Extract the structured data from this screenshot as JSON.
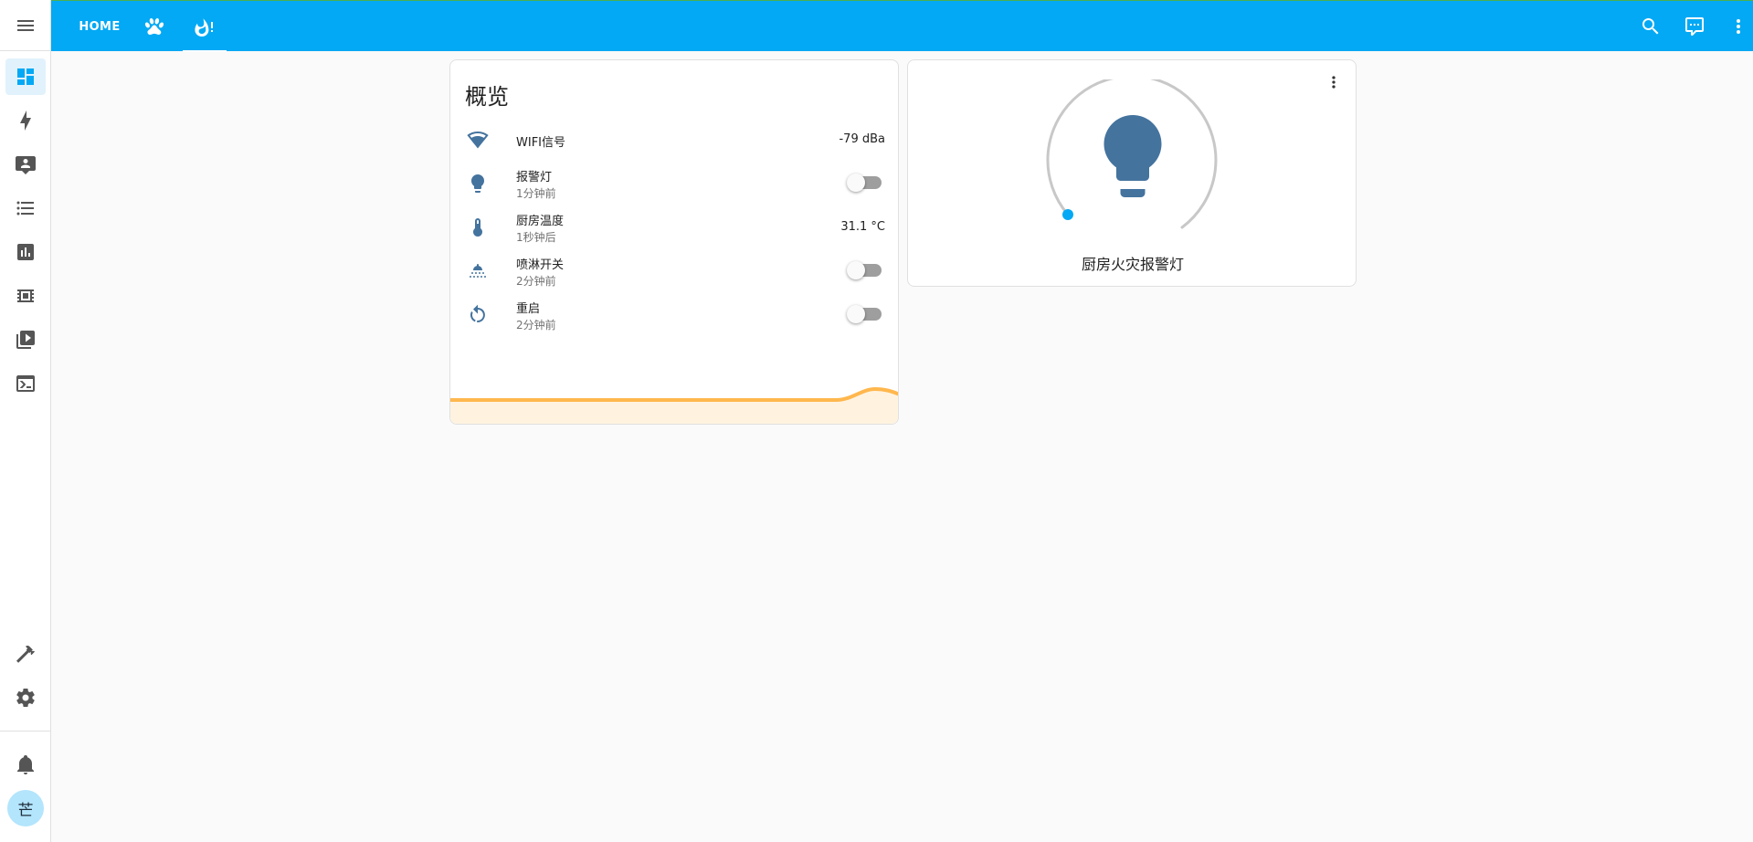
{
  "header": {
    "tabs": [
      {
        "label": "HOME",
        "icon": "home-text"
      },
      {
        "label": "",
        "icon": "paw-icon"
      },
      {
        "label": "",
        "icon": "fire-alert-icon",
        "active": true
      }
    ]
  },
  "sidebar": {
    "items": [
      {
        "icon": "dashboard-icon",
        "active": true
      },
      {
        "icon": "energy-bolt-icon"
      },
      {
        "icon": "map-person-icon"
      },
      {
        "icon": "logbook-list-icon"
      },
      {
        "icon": "history-chart-icon"
      },
      {
        "icon": "esphome-chip-icon"
      },
      {
        "icon": "media-icon"
      },
      {
        "icon": "terminal-icon"
      },
      {
        "icon": "developer-tools-hammer-icon"
      },
      {
        "icon": "settings-gear-icon"
      },
      {
        "icon": "notifications-bell-icon"
      }
    ],
    "avatar": "芒"
  },
  "overview_card": {
    "title": "概览",
    "rows": [
      {
        "name": "WIFI信号",
        "value": "-79 dBa",
        "icon": "wifi-icon"
      },
      {
        "name": "报警灯",
        "sub": "1分钟前",
        "icon": "lightbulb-icon",
        "toggle": false
      },
      {
        "name": "厨房温度",
        "sub": "1秒钟后",
        "value": "31.1 °C",
        "icon": "thermometer-icon"
      },
      {
        "name": "喷淋开关",
        "sub": "2分钟前",
        "icon": "sprinkler-icon",
        "toggle": false
      },
      {
        "name": "重启",
        "sub": "2分钟前",
        "icon": "restart-icon",
        "toggle": false
      }
    ]
  },
  "light_card": {
    "name": "厨房火灾报警灯",
    "icon": "lightbulb-icon"
  },
  "colors": {
    "primary": "#03a9f4",
    "state_icon": "#44739e",
    "graph": "#ffb74d"
  }
}
